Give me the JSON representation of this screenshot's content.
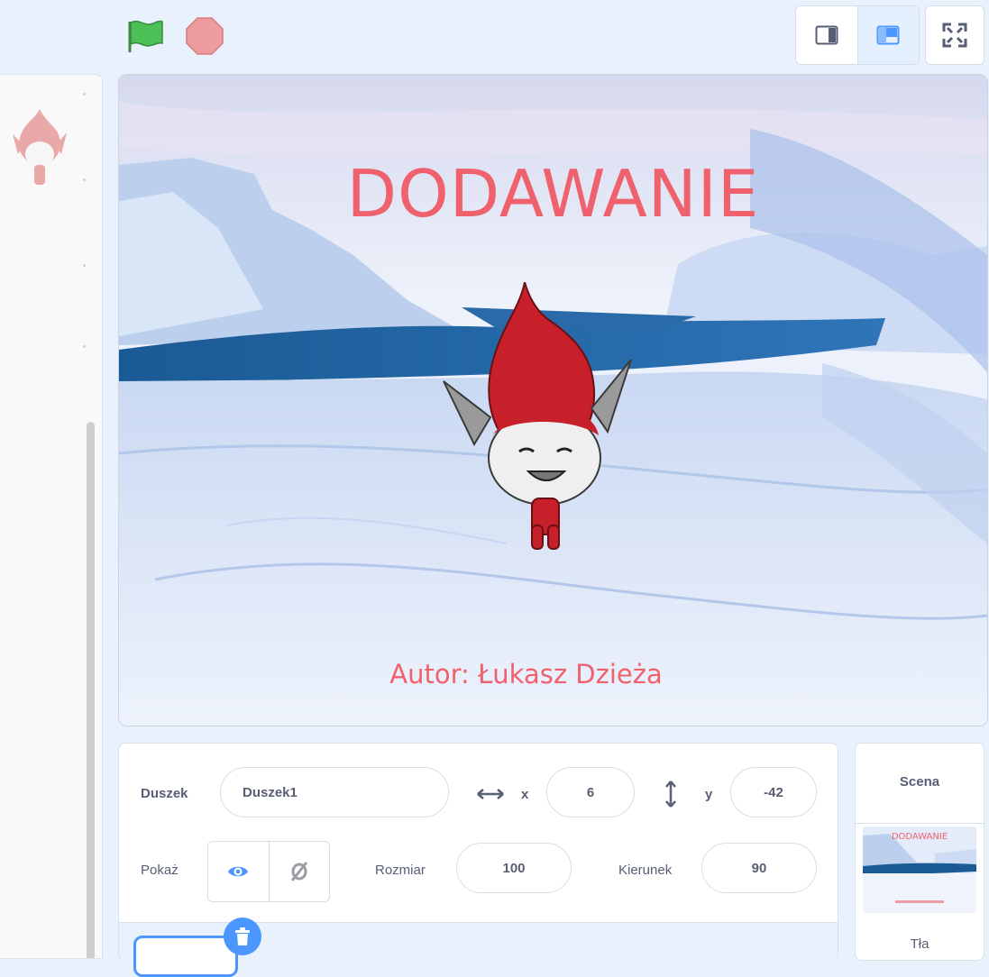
{
  "toolbar": {
    "green_flag_icon": "green-flag-icon",
    "stop_icon": "stop-icon",
    "layout_small_icon": "small-stage-icon",
    "layout_normal_icon": "normal-stage-icon",
    "fullscreen_icon": "fullscreen-icon"
  },
  "stage": {
    "title_text": "DODAWANIE",
    "author_text": "Autor: Łukasz Dzieża"
  },
  "sprite_info": {
    "sprite_label": "Duszek",
    "sprite_name": "Duszek1",
    "x_label": "x",
    "x_value": "6",
    "y_label": "y",
    "y_value": "-42",
    "show_label": "Pokaż",
    "size_label": "Rozmiar",
    "size_value": "100",
    "direction_label": "Kierunek",
    "direction_value": "90"
  },
  "scene_panel": {
    "title": "Scena",
    "thumbnail_title": "DODAWANIE",
    "backdrops_label": "Tła"
  },
  "colors": {
    "accent": "#4c97ff",
    "title_red": "#f0616e",
    "flag_green": "#4cbf56",
    "stop_red": "#ec9c9c",
    "text_gray": "#575e75"
  }
}
